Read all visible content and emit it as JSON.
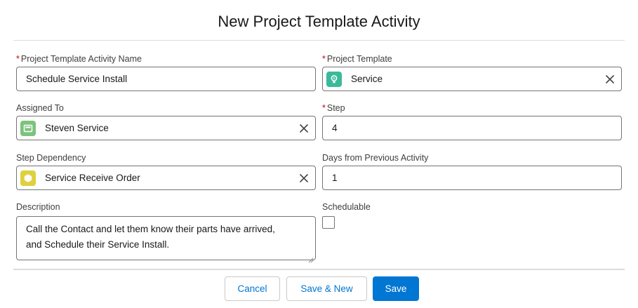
{
  "modal": {
    "title": "New Project Template Activity"
  },
  "fields": {
    "activity_name": {
      "label": "Project Template Activity Name",
      "required": "*",
      "value": "Schedule Service Install"
    },
    "project_template": {
      "label": "Project Template",
      "required": "*",
      "value": "Service",
      "icon": "lightbulb-icon",
      "icon_color": "#3bba9b"
    },
    "assigned_to": {
      "label": "Assigned To",
      "value": "Steven Service",
      "icon": "user-card-icon",
      "icon_color": "#7dc37d"
    },
    "step": {
      "label": "Step",
      "required": "*",
      "value": "4"
    },
    "step_dependency": {
      "label": "Step Dependency",
      "value": "Service Receive Order",
      "icon": "hexagon-icon",
      "icon_color": "#dfd13d"
    },
    "days_from_previous": {
      "label": "Days from Previous Activity",
      "value": "1"
    },
    "description": {
      "label": "Description",
      "value_line1": "Call the Contact and let them know their parts have arrived,",
      "value_line2": "and Schedule their Service Install."
    },
    "schedulable": {
      "label": "Schedulable",
      "checked": false
    }
  },
  "footer": {
    "cancel_label": "Cancel",
    "save_new_label": "Save & New",
    "save_label": "Save"
  },
  "colors": {
    "brand": "#0176d3",
    "required": "#ba0517",
    "border": "#747474"
  }
}
